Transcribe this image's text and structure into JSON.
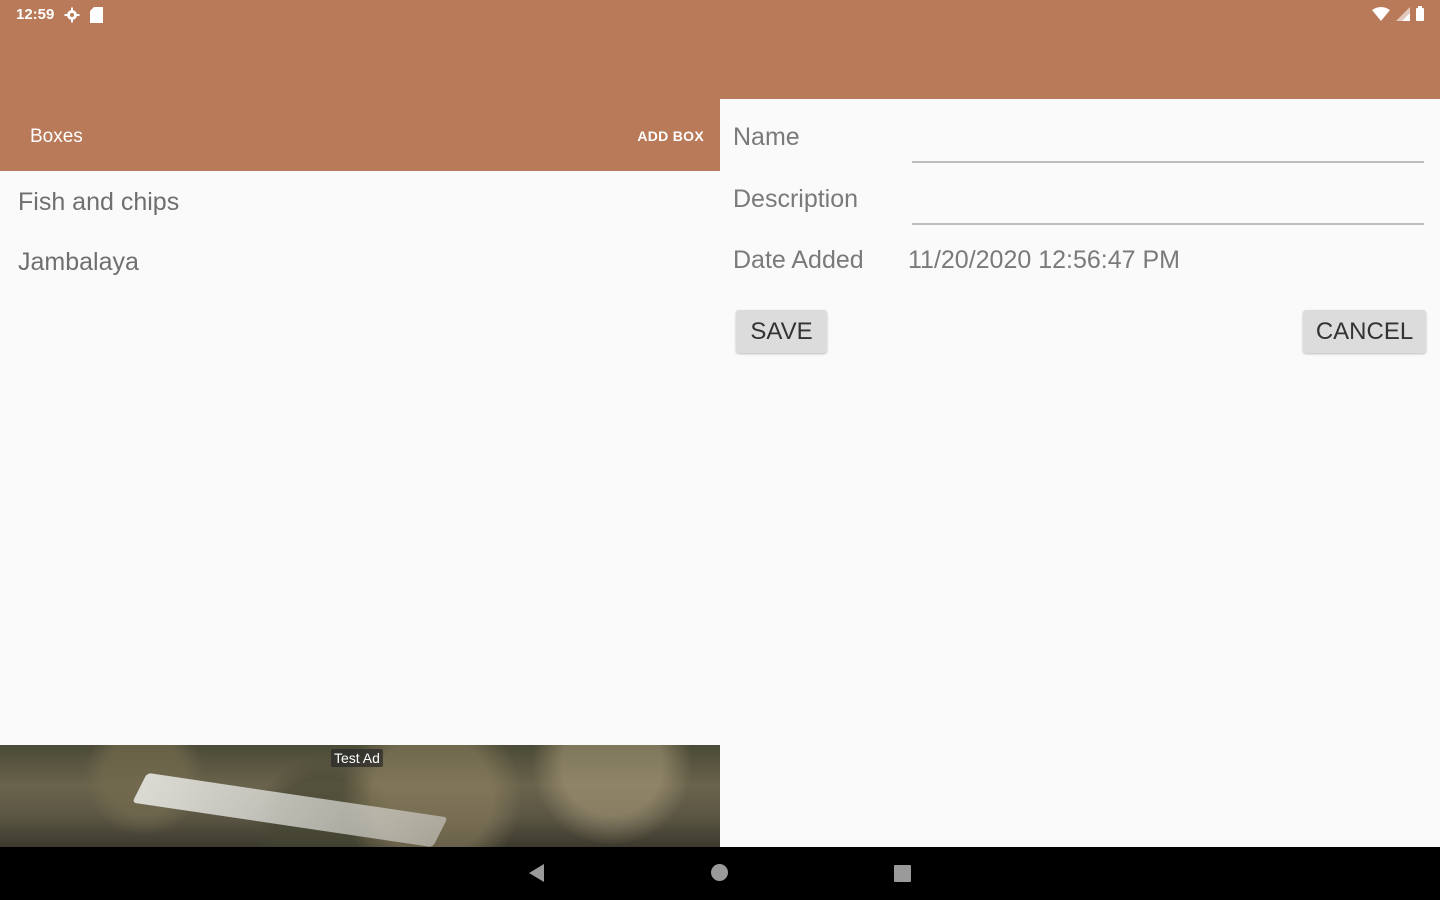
{
  "status_bar": {
    "time": "12:59",
    "left_icons": [
      "settings-icon",
      "sd-card-icon"
    ],
    "right_icons": [
      "wifi-icon",
      "signal-icon",
      "battery-icon"
    ]
  },
  "toolbar": {
    "title": "Boxes",
    "add_box_label": "ADD BOX"
  },
  "list": {
    "items": [
      {
        "label": "Fish and chips"
      },
      {
        "label": "Jambalaya"
      }
    ]
  },
  "ad": {
    "label": "Test Ad"
  },
  "form": {
    "name_label": "Name",
    "name_value": "",
    "description_label": "Description",
    "description_value": "",
    "date_added_label": "Date Added",
    "date_added_value": "11/20/2020 12:56:47 PM",
    "save_label": "SAVE",
    "cancel_label": "CANCEL"
  },
  "navigation": {
    "icons": [
      "back-icon",
      "home-icon",
      "recents-icon"
    ]
  },
  "colors": {
    "accent": "#b87a58",
    "background": "#fafafa",
    "nav_bar": "#000000"
  }
}
